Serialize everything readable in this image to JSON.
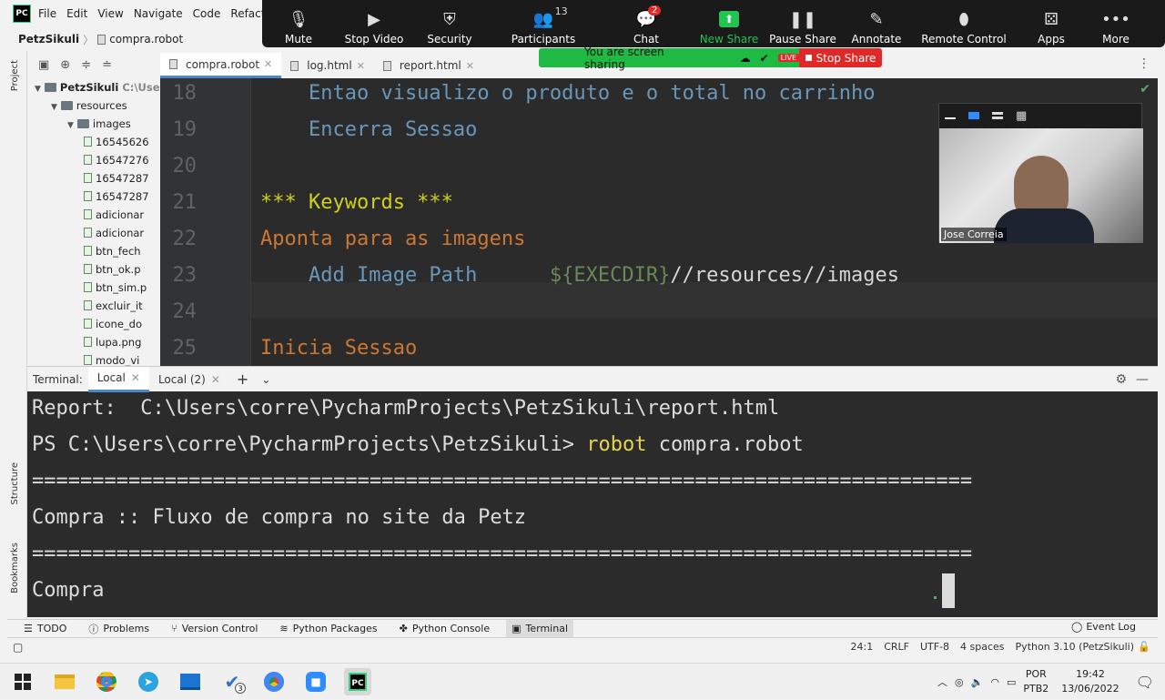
{
  "ide": {
    "logo": "PC",
    "menu": [
      "File",
      "Edit",
      "View",
      "Navigate",
      "Code",
      "Refactor"
    ],
    "breadcrumb": {
      "project": "PetzSikuli",
      "separator": "〉",
      "file": "compra.robot"
    },
    "side_tabs": {
      "project": "Project",
      "structure": "Structure",
      "bookmarks": "Bookmarks"
    },
    "tree": [
      {
        "label": "PetzSikuli",
        "suffix": "C:\\Users",
        "kind": "folder",
        "level": 0
      },
      {
        "label": "resources",
        "kind": "folder",
        "level": 1
      },
      {
        "label": "images",
        "kind": "folder",
        "level": 2
      },
      {
        "label": "16545626",
        "kind": "file",
        "level": 3
      },
      {
        "label": "16547276",
        "kind": "file",
        "level": 3
      },
      {
        "label": "16547287",
        "kind": "file",
        "level": 3
      },
      {
        "label": "16547287",
        "kind": "file",
        "level": 3
      },
      {
        "label": "adicionar",
        "kind": "file",
        "level": 3
      },
      {
        "label": "adicionar",
        "kind": "file",
        "level": 3
      },
      {
        "label": "btn_fech",
        "kind": "file",
        "level": 3
      },
      {
        "label": "btn_ok.p",
        "kind": "file",
        "level": 3
      },
      {
        "label": "btn_sim.p",
        "kind": "file",
        "level": 3
      },
      {
        "label": "excluir_it",
        "kind": "file",
        "level": 3
      },
      {
        "label": "icone_do",
        "kind": "file",
        "level": 3
      },
      {
        "label": "lupa.png",
        "kind": "file",
        "level": 3
      },
      {
        "label": "modo_vi",
        "kind": "file",
        "level": 3
      }
    ],
    "editor_tabs": [
      {
        "label": "compra.robot",
        "active": true
      },
      {
        "label": "log.html",
        "active": false
      },
      {
        "label": "report.html",
        "active": false
      }
    ],
    "code_lines": [
      {
        "num": "18",
        "parts": [
          {
            "t": "    Entao visualizo o produto e o total no carrinho",
            "c": "#6897bb"
          }
        ]
      },
      {
        "num": "19",
        "parts": [
          {
            "t": "    Encerra Sessao",
            "c": "#6897bb"
          }
        ]
      },
      {
        "num": "20",
        "parts": [
          {
            "t": "",
            "c": "#a9b7c6"
          }
        ]
      },
      {
        "num": "21",
        "parts": [
          {
            "t": "*** Keywords ***",
            "c": "#d0d01a"
          }
        ]
      },
      {
        "num": "22",
        "parts": [
          {
            "t": "Aponta para as imagens",
            "c": "#cc7832"
          }
        ]
      },
      {
        "num": "23",
        "parts": [
          {
            "t": "    Add Image Path      ",
            "c": "#6897bb"
          },
          {
            "t": "${EXECDIR}",
            "c": "#6a8759"
          },
          {
            "t": "//resources//images",
            "c": "#d6d6d6"
          }
        ]
      },
      {
        "num": "24",
        "parts": [
          {
            "t": "",
            "c": "#a9b7c6"
          }
        ]
      },
      {
        "num": "25",
        "parts": [
          {
            "t": "Inicia Sessao",
            "c": "#cc7832"
          }
        ]
      }
    ],
    "terminal": {
      "label": "Terminal:",
      "tabs": [
        {
          "label": "Local",
          "active": true
        },
        {
          "label": "Local (2)",
          "active": false
        }
      ],
      "add": "+",
      "lines": [
        {
          "text": "Report:  C:\\Users\\corre\\PycharmProjects\\PetzSikuli\\report.html"
        },
        {
          "prompt": "PS C:\\Users\\corre\\PycharmProjects\\PetzSikuli> ",
          "cmd": "robot",
          "rest": " compra.robot"
        },
        {
          "text": "=============================================================================="
        },
        {
          "text": "Compra :: Fluxo de compra no site da Petz"
        },
        {
          "text": "=============================================================================="
        },
        {
          "text": "Compra"
        }
      ]
    },
    "bottom_tools": [
      {
        "label": "TODO",
        "icon": "list-icon"
      },
      {
        "label": "Problems",
        "icon": "info-icon"
      },
      {
        "label": "Version Control",
        "icon": "branch-icon"
      },
      {
        "label": "Python Packages",
        "icon": "layers-icon"
      },
      {
        "label": "Python Console",
        "icon": "python-icon"
      },
      {
        "label": "Terminal",
        "icon": "terminal-icon",
        "active": true
      }
    ],
    "event_log": "Event Log",
    "status": {
      "position": "24:1",
      "line_sep": "CRLF",
      "encoding": "UTF-8",
      "indent": "4 spaces",
      "interpreter": "Python 3.10 (PetzSikuli)"
    }
  },
  "zoom": {
    "buttons": [
      {
        "label": "Mute",
        "icon": "mic-icon"
      },
      {
        "label": "Stop Video",
        "icon": "camera-icon"
      },
      {
        "label": "Security",
        "icon": "shield-icon"
      },
      {
        "label": "Participants",
        "icon": "people-icon",
        "badge": "13"
      },
      {
        "label": "Chat",
        "icon": "chat-icon",
        "badge": "2"
      },
      {
        "label": "New Share",
        "icon": "share-icon"
      },
      {
        "label": "Pause Share",
        "icon": "pause-icon"
      },
      {
        "label": "Annotate",
        "icon": "pen-icon"
      },
      {
        "label": "Remote Control",
        "icon": "mouse-icon"
      },
      {
        "label": "Apps",
        "icon": "apps-icon"
      },
      {
        "label": "More",
        "icon": "more-icon"
      }
    ],
    "sharing_text": "You are screen sharing",
    "live": "LIVE",
    "stop_share": "Stop Share",
    "participant_name": "Jose Correia"
  },
  "taskbar": {
    "lang": "POR",
    "kb": "PTB2",
    "time": "19:42",
    "date": "13/06/2022",
    "vscode_badge": "3"
  }
}
